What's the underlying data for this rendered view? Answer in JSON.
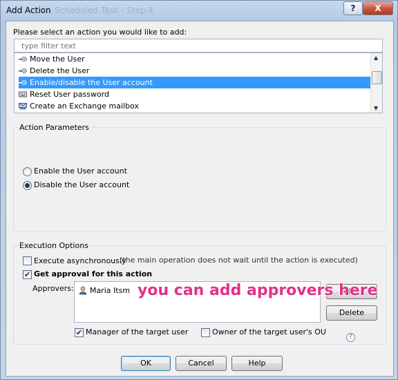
{
  "window": {
    "title": "Add Action",
    "subtitle_faded": "Scheduled Task - Step 4"
  },
  "titlebar_buttons": {
    "help": "?",
    "close": "X"
  },
  "prompt": "Please select an action you would like to add:",
  "filter": {
    "placeholder": "type filter text",
    "value": ""
  },
  "actions": [
    {
      "label": "Move the User",
      "icon": "gear-arrow-icon",
      "selected": false
    },
    {
      "label": "Delete the User",
      "icon": "gear-arrow-icon",
      "selected": false
    },
    {
      "label": "Enable/disable the User account",
      "icon": "gear-arrow-icon",
      "selected": true
    },
    {
      "label": "Reset User password",
      "icon": "keyboard-icon",
      "selected": false
    },
    {
      "label": "Create an Exchange mailbox",
      "icon": "mailbox-icon",
      "selected": false
    }
  ],
  "action_parameters": {
    "group_label": "Action Parameters",
    "options": [
      {
        "label": "Enable the User account",
        "checked": false
      },
      {
        "label": "Disable the User account",
        "checked": true
      }
    ]
  },
  "execution_options": {
    "group_label": "Execution Options",
    "async_label": "Execute asynchronously",
    "async_checked": false,
    "async_note": "(the main operation does not wait until the action is executed)",
    "approval_label": "Get approval for this action",
    "approval_checked": true,
    "approvers_label": "Approvers:",
    "approvers": [
      "Maria Itsm"
    ],
    "add_button": "Add...",
    "delete_button": "Delete",
    "manager_label": "Manager of the target user",
    "manager_checked": true,
    "owner_label": "Owner of the target user's OU",
    "owner_checked": false,
    "help_glyph": "?"
  },
  "annotation": "you can add approvers here",
  "buttons": {
    "ok": "OK",
    "cancel": "Cancel",
    "help": "Help"
  },
  "colors": {
    "selection": "#3399ff",
    "annotation": "#e0338a"
  }
}
